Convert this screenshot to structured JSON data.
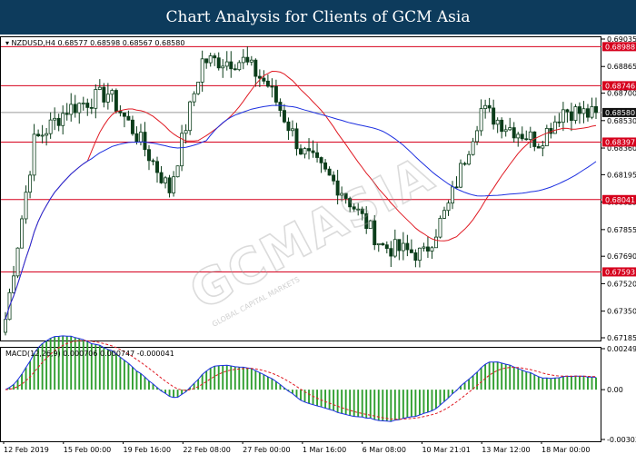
{
  "header": {
    "title": "Chart Analysis for Clients of GCM Asia"
  },
  "watermark": {
    "text": "GCMASIA",
    "subtext": "GLOBAL CAPITAL MARKETS"
  },
  "colors": {
    "candle": "#0b3d1a",
    "ma_fast": "#e01b24",
    "ma_slow": "#1c2fe0",
    "level_line": "#d6001c",
    "macd_hist": "#2e9e2e",
    "macd_signal": "#e01b24",
    "macd_line": "#1c2fe0"
  },
  "chart_data": [
    {
      "type": "candlestick",
      "label": "NZDUSD,H4  0.68577 0.68598 0.68567 0.68580",
      "symbol": "NZDUSD",
      "timeframe": "H4",
      "ohlc_last": [
        0.68577,
        0.68598,
        0.68567,
        0.6858
      ],
      "ylim": [
        0.67185,
        0.69035
      ],
      "y_ticks": [
        "0.69035",
        "0.68865",
        "0.68700",
        "0.68530",
        "0.68360",
        "0.68195",
        "0.68025",
        "0.67855",
        "0.67690",
        "0.67520",
        "0.67350",
        "0.67185"
      ],
      "x_ticks": [
        "12 Feb 2019",
        "15 Feb 00:00",
        "19 Feb 16:00",
        "22 Feb 08:00",
        "27 Feb 00:00",
        "1 Mar 16:00",
        "6 Mar 08:00",
        "10 Mar 21:01",
        "13 Mar 12:00",
        "18 Mar 00:00"
      ],
      "price_levels": [
        "0.68988",
        "0.68746",
        "0.68397",
        "0.68041",
        "0.67593"
      ],
      "current_price": "0.68580",
      "trend": [
        [
          0,
          0.673
        ],
        [
          7,
          0.684
        ],
        [
          15,
          0.686
        ],
        [
          25,
          0.687
        ],
        [
          33,
          0.684
        ],
        [
          40,
          0.681
        ],
        [
          48,
          0.689
        ],
        [
          58,
          0.689
        ],
        [
          64,
          0.6875
        ],
        [
          72,
          0.6835
        ],
        [
          82,
          0.681
        ],
        [
          92,
          0.6775
        ],
        [
          102,
          0.677
        ],
        [
          108,
          0.68
        ],
        [
          116,
          0.686
        ],
        [
          122,
          0.685
        ],
        [
          130,
          0.684
        ],
        [
          136,
          0.686
        ],
        [
          144,
          0.6856
        ]
      ],
      "series": [
        {
          "type": "ma",
          "color_key": "ma_fast",
          "period": 21
        },
        {
          "type": "ma",
          "color_key": "ma_slow",
          "period": 50
        }
      ]
    },
    {
      "type": "macd",
      "label": "MACD(12,26,9) 0.000706 0.000747 -0.000041",
      "values": [
        0.000706,
        0.000747,
        -4.1e-05
      ],
      "ylim": [
        -0.00303,
        0.002492
      ],
      "y_ticks": [
        "0.002492",
        "0.00",
        "-0.00303"
      ]
    }
  ]
}
